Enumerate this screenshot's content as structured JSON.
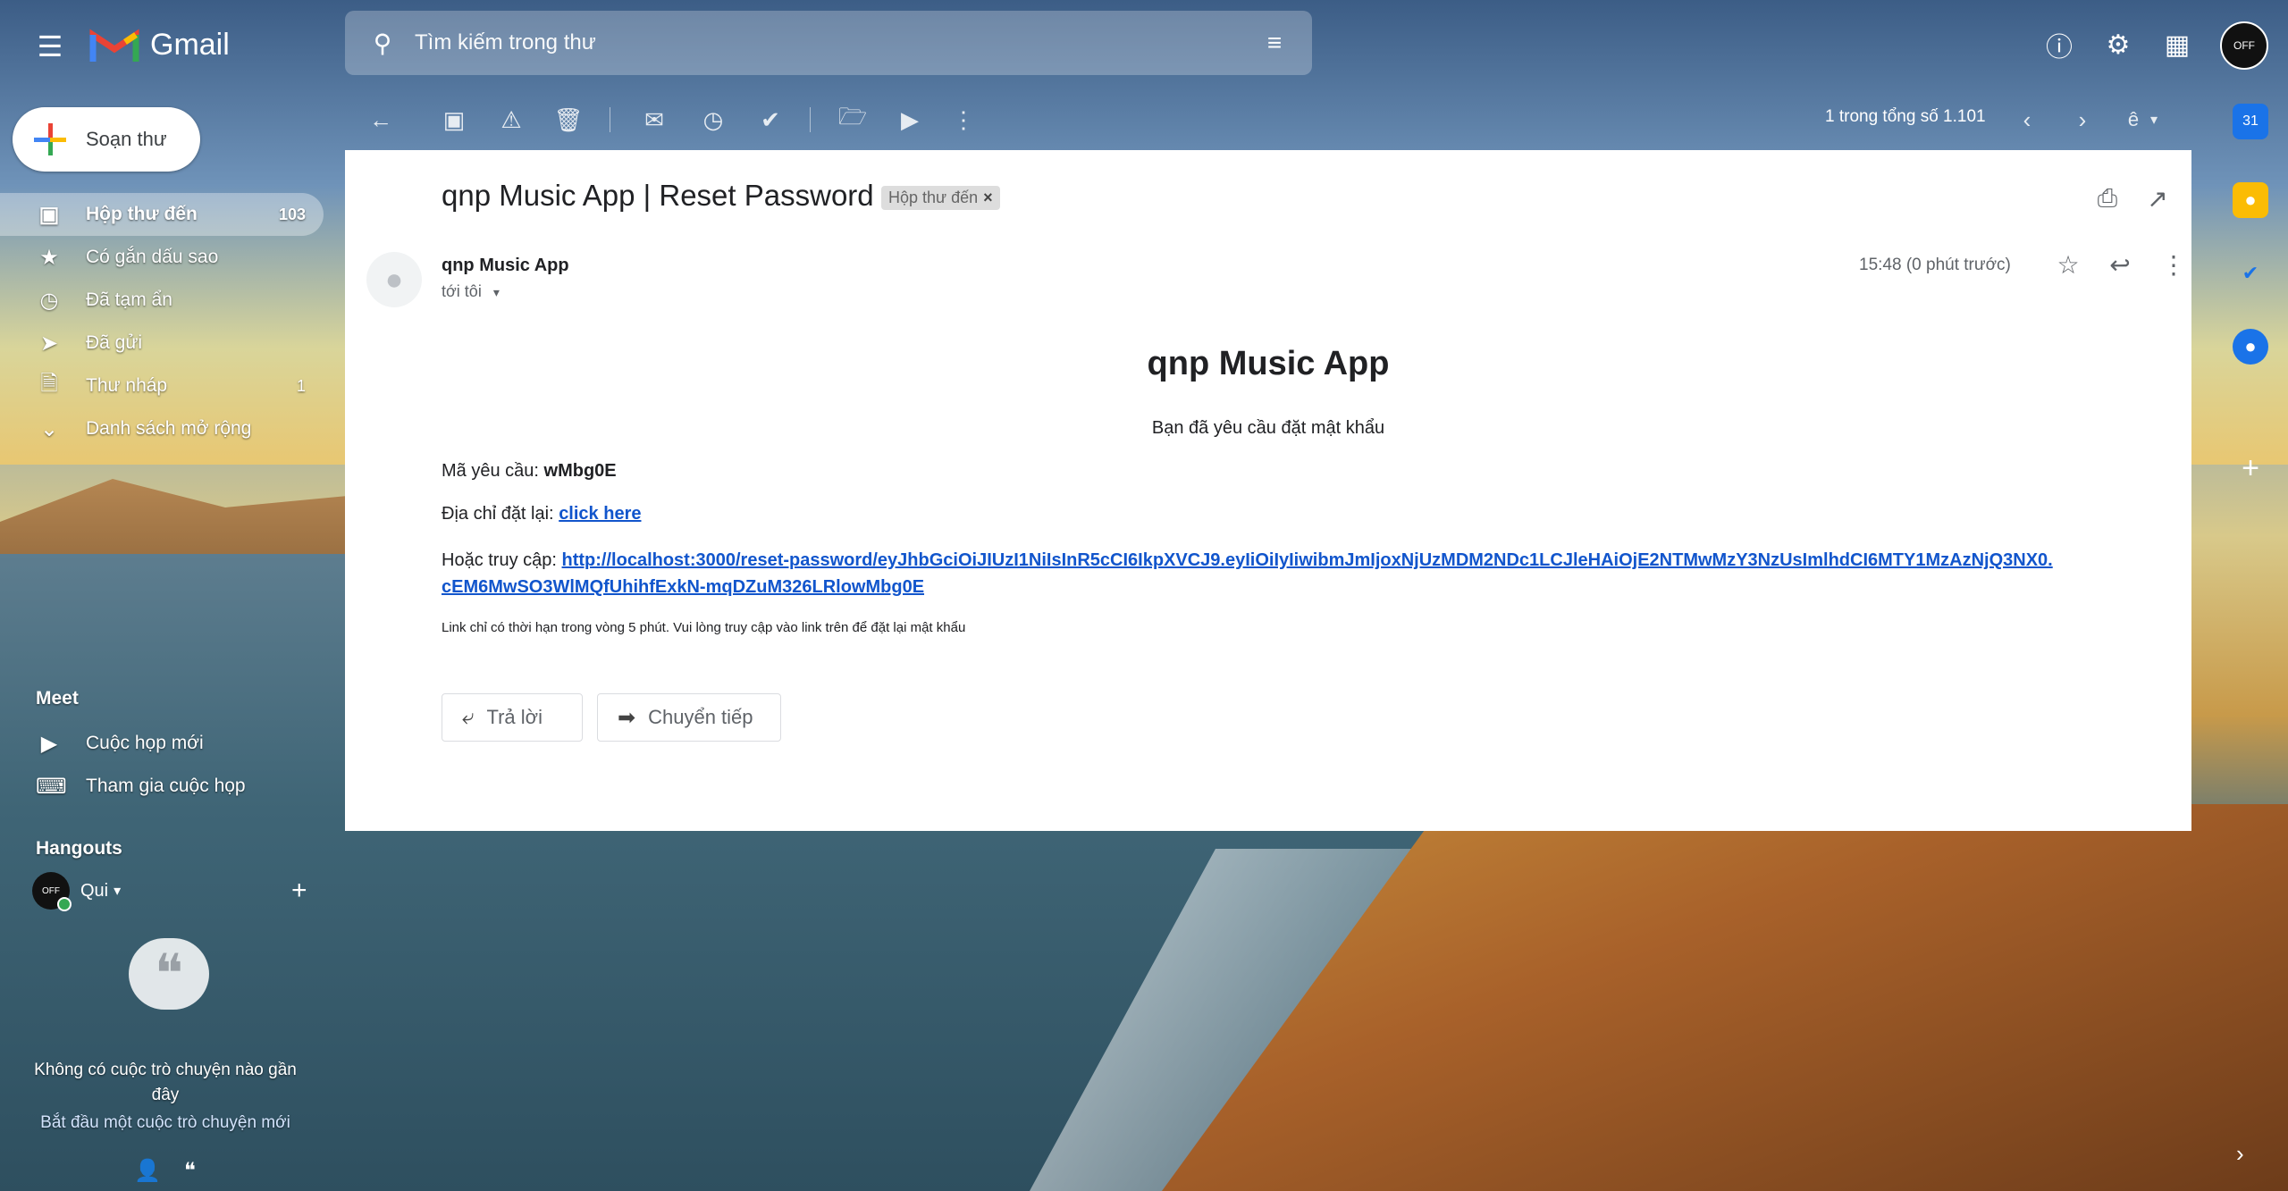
{
  "app": {
    "name": "Gmail"
  },
  "search": {
    "placeholder": "Tìm kiếm trong thư"
  },
  "compose": {
    "label": "Soạn thư"
  },
  "nav": [
    {
      "label": "Hộp thư đến",
      "count": "103",
      "icon": "inbox-icon"
    },
    {
      "label": "Có gắn dấu sao",
      "count": "",
      "icon": "star-icon"
    },
    {
      "label": "Đã tạm ẩn",
      "count": "",
      "icon": "clock-icon"
    },
    {
      "label": "Đã gửi",
      "count": "",
      "icon": "send-icon"
    },
    {
      "label": "Thư nháp",
      "count": "1",
      "icon": "draft-icon"
    },
    {
      "label": "Danh sách mở rộng",
      "count": "",
      "icon": "chevron-down-icon"
    }
  ],
  "meet": {
    "title": "Meet",
    "items": [
      {
        "label": "Cuộc họp mới",
        "icon": "video-icon"
      },
      {
        "label": "Tham gia cuộc họp",
        "icon": "keyboard-icon"
      }
    ]
  },
  "hangouts": {
    "title": "Hangouts",
    "user": "Qui",
    "empty": "Không có cuộc trò chuyện nào gần đây",
    "start": "Bắt đầu một cuộc trò chuyện mới"
  },
  "toolbar": {
    "pager": "1 trong tổng số 1.101",
    "lang": "ê"
  },
  "message": {
    "subject": "qnp Music App | Reset Password",
    "label_chip": "Hộp thư đến",
    "sender": "qnp Music App",
    "to": "tới tôi",
    "time": "15:48 (0 phút trước)",
    "body_title": "qnp Music App",
    "body_sub": "Bạn đã yêu cầu đặt mật khẩu",
    "code_label": "Mã yêu cầu:",
    "code": "wMbg0E",
    "reset_label": "Địa chỉ đặt lại:",
    "reset_link": "click here",
    "access_label": "Hoặc truy cập:",
    "url_line1": "http://localhost:3000/reset-password/eyJhbGciOiJIUzI1NiIsInR5cCI6IkpXVCJ9.eyIiOiIyIiwibmJmIjoxNjUzMDM2NDc1LCJleHAiOjE2NTMwMzY3NzUsImlhdCI6MTY1MzAzNjQ3NX0.",
    "url_line2": "cEM6MwSO3WlMQfUhihfExkN-mqDZuM326LRlowMbg0E",
    "note": "Link chỉ có thời hạn trong vòng 5 phút. Vui lòng truy cập vào link trên để đặt lại mật khẩu",
    "reply": "Trả lời",
    "forward": "Chuyển tiếp"
  },
  "colors": {
    "link": "#1155cc",
    "accent": "#1a73e8"
  }
}
